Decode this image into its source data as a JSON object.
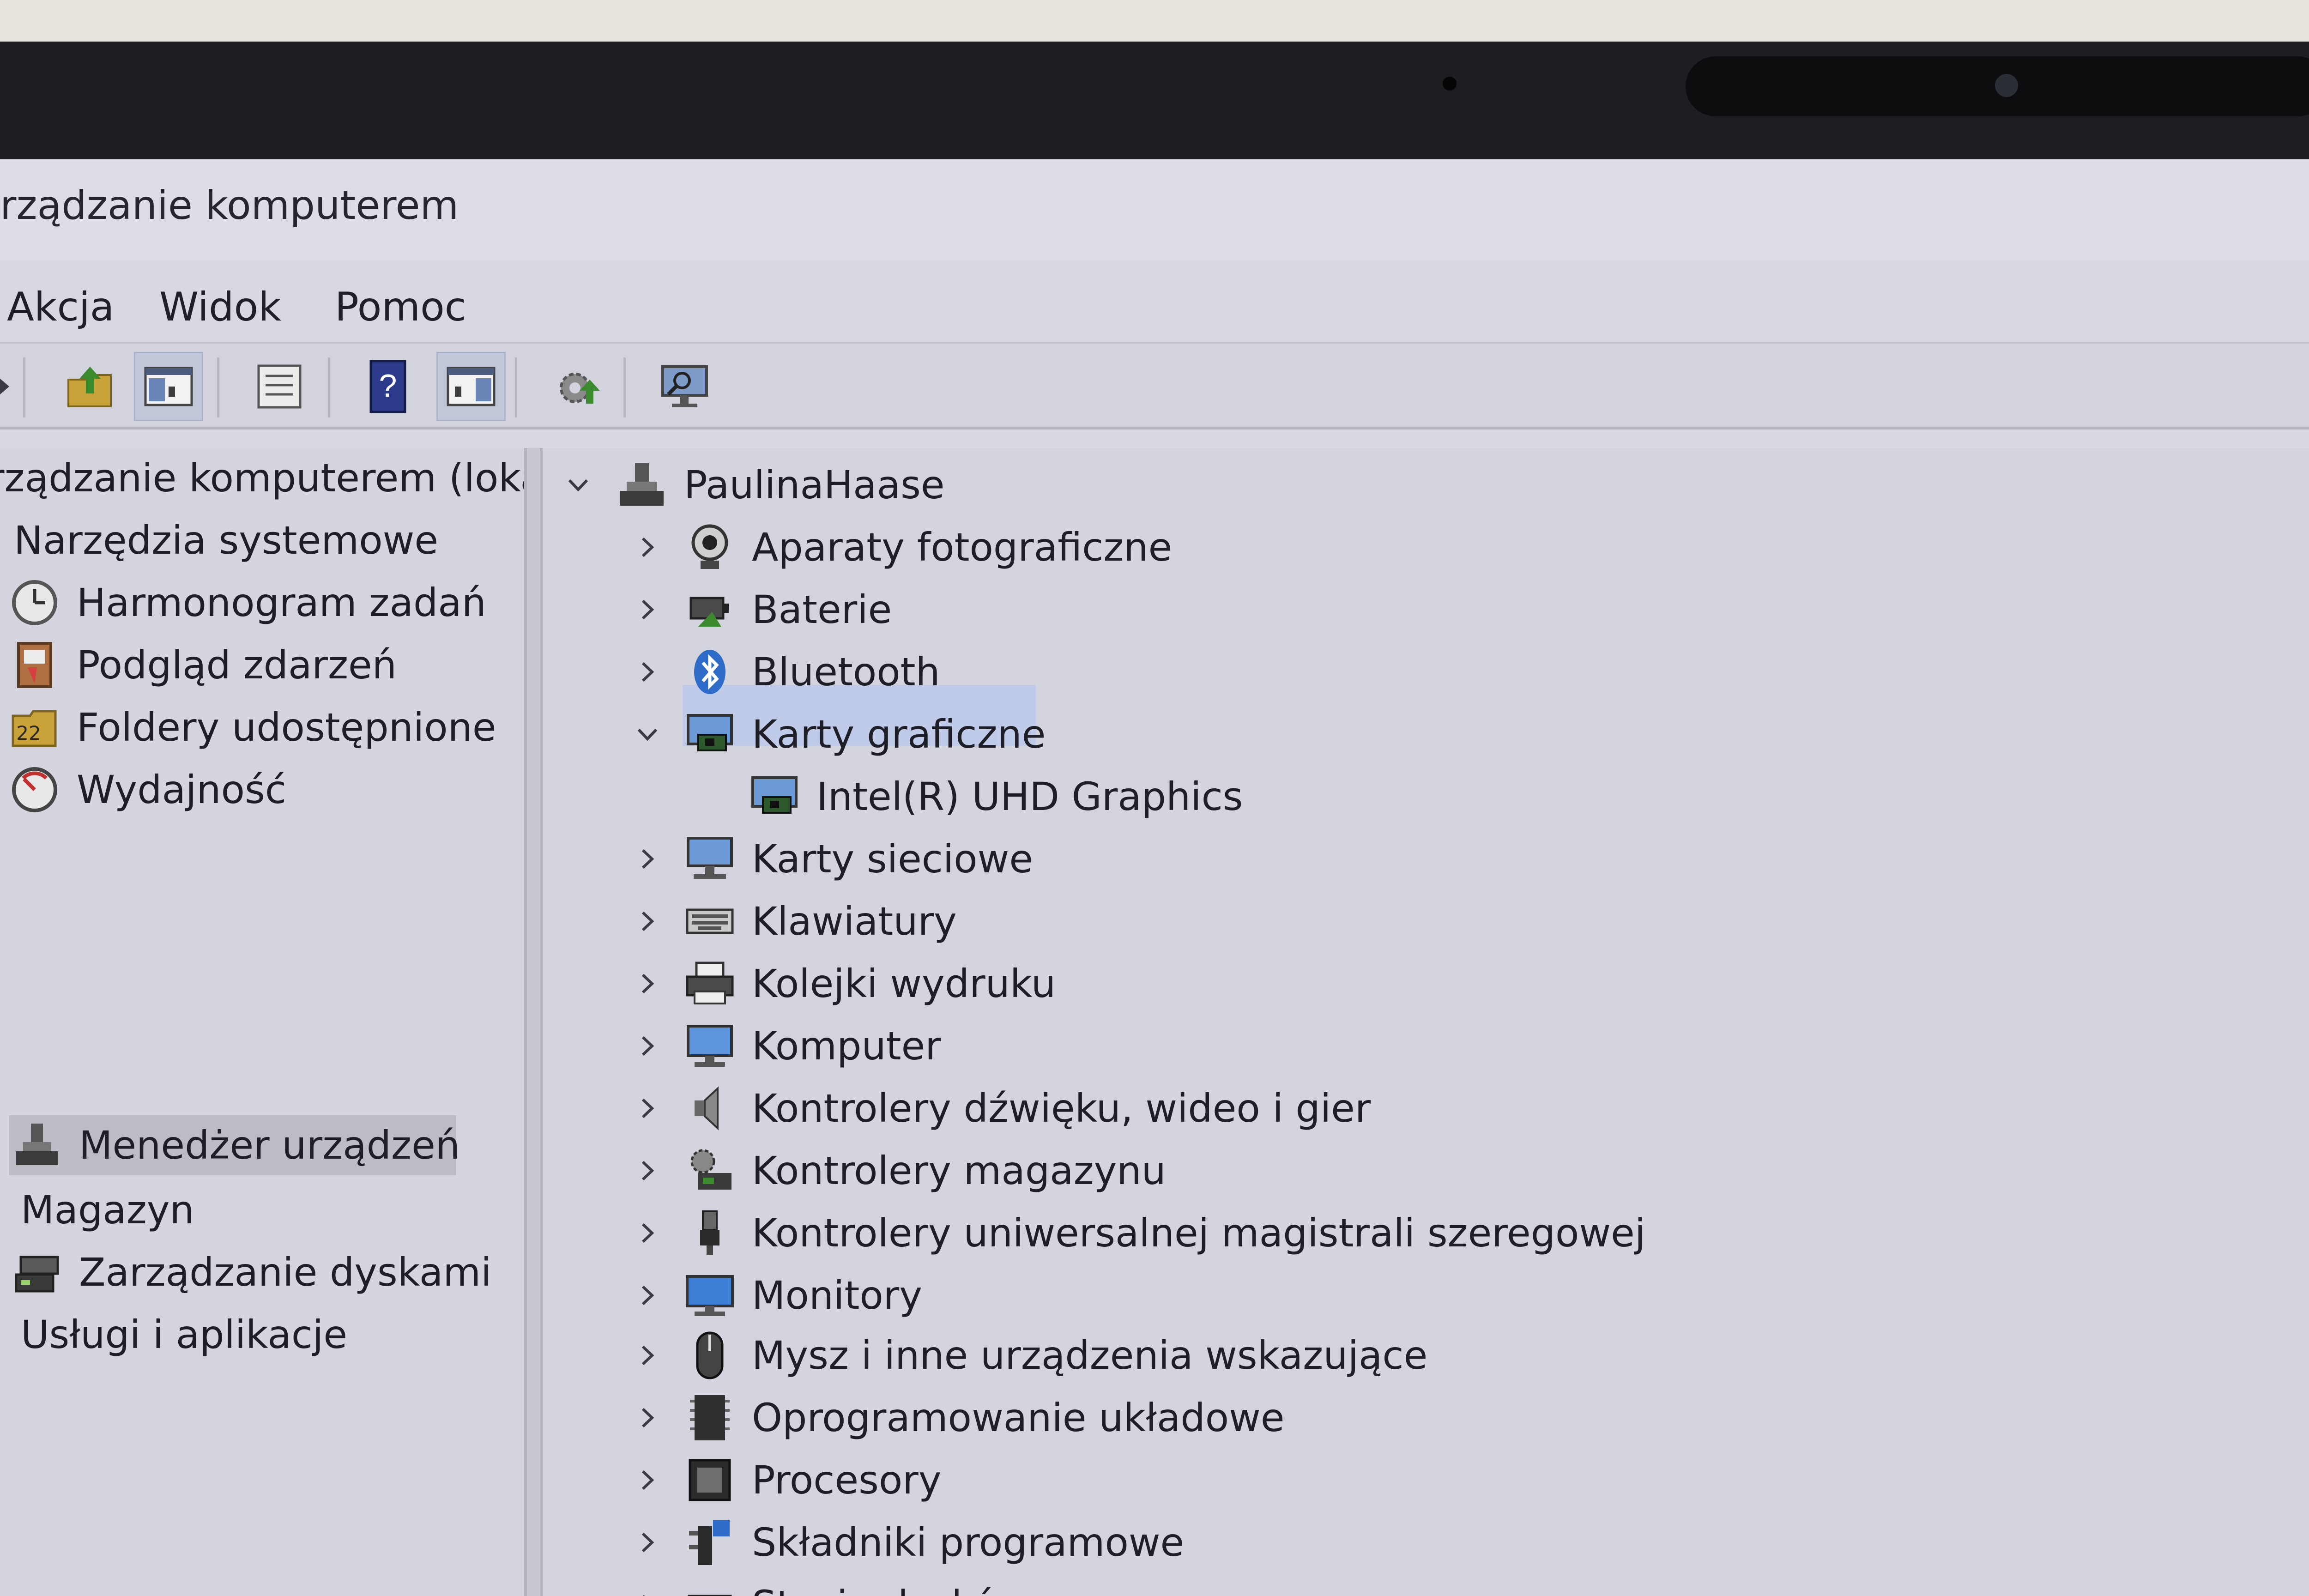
{
  "window": {
    "title": "rządzanie komputerem"
  },
  "menu": {
    "items": [
      "Akcja",
      "Widok",
      "Pomoc"
    ]
  },
  "left_tree": {
    "root_label": "rządzanie komputerem (lokal",
    "group_system": "Narzędzia systemowe",
    "items": [
      {
        "label": "Harmonogram zadań",
        "icon": "clock-icon"
      },
      {
        "label": "Podgląd zdarzeń",
        "icon": "event-viewer-icon"
      },
      {
        "label": "Foldery udostępnione",
        "icon": "shared-folder-icon"
      },
      {
        "label": "Wydajność",
        "icon": "performance-icon"
      },
      {
        "label": "Menedżer urządzeń",
        "icon": "device-manager-icon",
        "selected": true
      }
    ],
    "group_storage": "Magazyn",
    "storage_items": [
      {
        "label": "Zarządzanie dyskami",
        "icon": "disk-icon"
      }
    ],
    "group_services": "Usługi i aplikacje"
  },
  "device_tree": {
    "computer": "PaulinaHaase",
    "categories": [
      {
        "label": "Aparaty fotograficzne",
        "icon": "camera-icon"
      },
      {
        "label": "Baterie",
        "icon": "battery-icon"
      },
      {
        "label": "Bluetooth",
        "icon": "bluetooth-icon"
      },
      {
        "label": "Karty graficzne",
        "icon": "display-adapter-icon",
        "expanded": true,
        "selected": true
      },
      {
        "label": "Karty sieciowe",
        "icon": "network-adapter-icon"
      },
      {
        "label": "Klawiatury",
        "icon": "keyboard-icon"
      },
      {
        "label": "Kolejki wydruku",
        "icon": "printer-icon"
      },
      {
        "label": "Komputer",
        "icon": "computer-icon"
      },
      {
        "label": "Kontrolery dźwięku, wideo i gier",
        "icon": "speaker-icon"
      },
      {
        "label": "Kontrolery magazynu",
        "icon": "storage-controller-icon"
      },
      {
        "label": "Kontrolery uniwersalnej magistrali szeregowej",
        "icon": "usb-icon"
      },
      {
        "label": "Monitory",
        "icon": "monitor-icon"
      },
      {
        "label": "Mysz i inne urządzenia wskazujące",
        "icon": "mouse-icon"
      },
      {
        "label": "Oprogramowanie układowe",
        "icon": "firmware-icon"
      },
      {
        "label": "Procesory",
        "icon": "processor-icon"
      },
      {
        "label": "Składniki programowe",
        "icon": "software-component-icon"
      },
      {
        "label": "Stacje dysków",
        "icon": "disk-drive-icon"
      }
    ],
    "display_adapter_child": "Intel(R) UHD Graphics"
  }
}
